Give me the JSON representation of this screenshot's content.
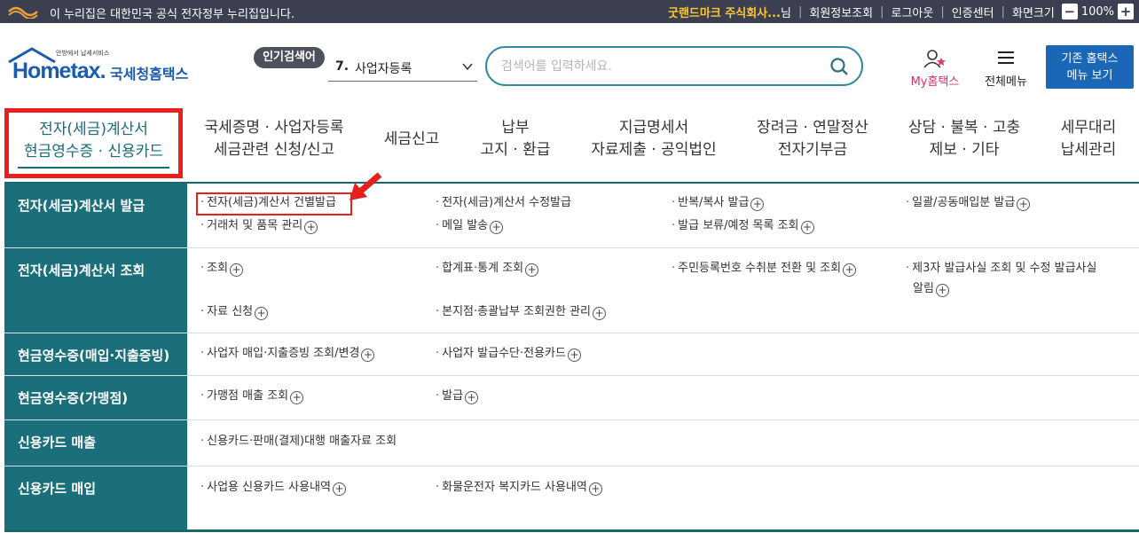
{
  "gov_bar": {
    "text": "이 누리집은 대한민국 공식 전자정부 누리집입니다.",
    "company": "굿랜드마크 주식회사...",
    "honorific": "님",
    "links": [
      "회원정보조회",
      "로그아웃",
      "인증센터",
      "화면크기"
    ],
    "zoom": "100%",
    "zoom_minus": "−",
    "zoom_plus": "+"
  },
  "header": {
    "logo_small": "안방에서 납세서비스",
    "logo_brand": "Hometax.",
    "logo_name": "국세청홈택스",
    "popular_badge": "인기검색어",
    "popular_num": "7.",
    "popular_text": "사업자등록",
    "search_placeholder": "검색어를 입력하세요.",
    "my_home": "My홈택스",
    "all_menu": "전체메뉴",
    "old_home_line1": "기존 홈택스",
    "old_home_line2": "메뉴 보기"
  },
  "nav": [
    {
      "line1": "전자(세금)계산서",
      "line2": "현금영수증 · 신용카드"
    },
    {
      "line1": "국세증명 · 사업자등록",
      "line2": "세금관련 신청/신고"
    },
    {
      "line1": "세금신고",
      "line2": ""
    },
    {
      "line1": "납부",
      "line2": "고지 · 환급"
    },
    {
      "line1": "지급명세서",
      "line2": "자료제출 · 공익법인"
    },
    {
      "line1": "장려금 · 연말정산",
      "line2": "전자기부금"
    },
    {
      "line1": "상담 · 불복 · 고충",
      "line2": "제보 · 기타"
    },
    {
      "line1": "세무대리",
      "line2": "납세관리"
    }
  ],
  "menu": [
    {
      "header": "전자(세금)계산서 발급",
      "items": [
        {
          "label": "전자(세금)계산서 건별발급",
          "plus": false
        },
        {
          "label": "전자(세금)계산서 수정발급",
          "plus": false
        },
        {
          "label": "반복/복사 발급",
          "plus": true
        },
        {
          "label": "일괄/공동매입분 발급",
          "plus": true
        },
        {
          "label": "거래처 및 품목 관리",
          "plus": true
        },
        {
          "label": "메일 발송",
          "plus": true
        },
        {
          "label": "발급 보류/예정 목록 조회",
          "plus": true
        }
      ]
    },
    {
      "header": "전자(세금)계산서 조회",
      "items": [
        {
          "label": "조회",
          "plus": true
        },
        {
          "label": "합계표·통계 조회",
          "plus": true
        },
        {
          "label": "주민등록번호 수취분 전환 및 조회",
          "plus": true
        },
        {
          "label": "제3자 발급사실 조회 및 수정 발급사실",
          "plus": false
        },
        {
          "label": "알림",
          "plus": true
        },
        {
          "label": "자료 신청",
          "plus": true
        },
        {
          "label": "본지점·총괄납부 조회권한 관리",
          "plus": true
        }
      ]
    },
    {
      "header": "현금영수증(매입·지출증빙)",
      "items": [
        {
          "label": "사업자 매입·지출증빙 조회/변경",
          "plus": true
        },
        {
          "label": "사업자 발급수단·전용카드",
          "plus": true
        }
      ]
    },
    {
      "header": "현금영수증(가맹점)",
      "items": [
        {
          "label": "가맹점 매출 조회",
          "plus": true
        },
        {
          "label": "발급",
          "plus": true
        }
      ]
    },
    {
      "header": "신용카드 매출",
      "items": [
        {
          "label": "신용카드·판매(결제)대행 매출자료 조회",
          "plus": false
        }
      ]
    },
    {
      "header": "신용카드 매입",
      "items": [
        {
          "label": "사업용 신용카드 사용내역",
          "plus": true
        },
        {
          "label": "화물운전자 복지카드 사용내역",
          "plus": true
        }
      ]
    }
  ],
  "colors": {
    "teal": "#1b6f7a",
    "highlight": "#e81f1f",
    "brand_blue": "#1b5cad",
    "govbar": "#3b3f4f"
  }
}
